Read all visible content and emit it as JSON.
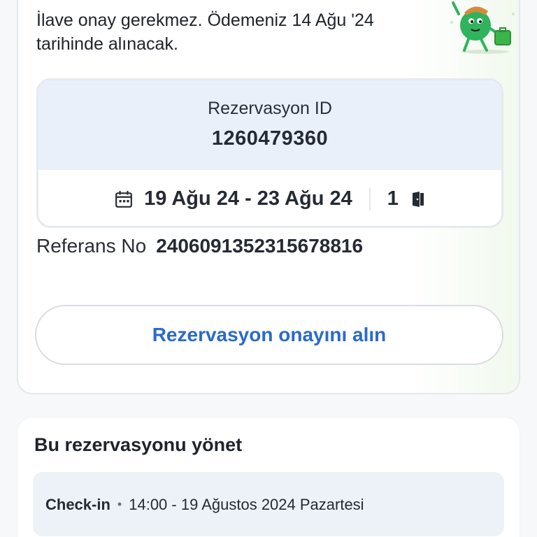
{
  "notice": {
    "line1": "İlave onay gerekmez. Ödemeniz 14 Ağu '24",
    "line2": "tarihinde alınacak."
  },
  "reservation": {
    "id_label": "Rezervasyon ID",
    "id_value": "1260479360",
    "dates": "19 Ağu 24 - 23 Ağu 24",
    "rooms": "1",
    "icons": {
      "calendar": "calendar-icon",
      "room": "door-icon"
    }
  },
  "reference": {
    "label": "Referans No",
    "value": "24060913523156788​16"
  },
  "cta": {
    "label": "Rezervasyon onayını alın"
  },
  "manage": {
    "title": "Bu rezervasyonu yönet",
    "checkin_label": "Check-in",
    "separator": "•",
    "checkin_value": "14:00 - 19 Ağustos 2024 Pazartesi"
  },
  "colors": {
    "accent": "#2a6acb",
    "header_bg": "#eaf0fa",
    "checkin_bg": "#edf2f9",
    "mascot_green": "#2fb35c"
  }
}
